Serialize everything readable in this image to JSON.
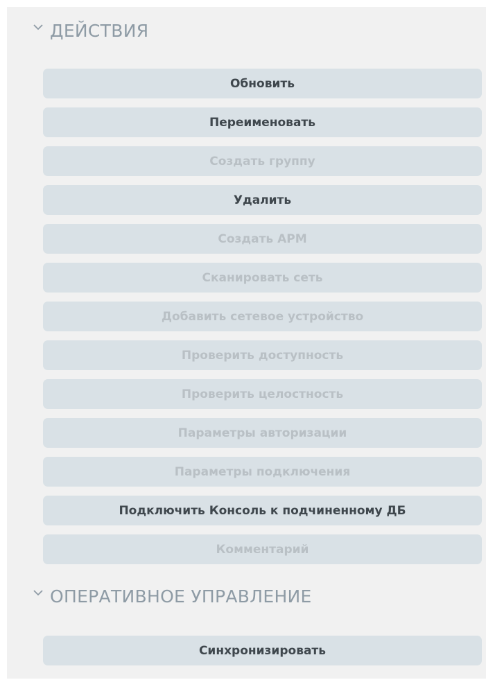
{
  "sections": [
    {
      "title": "ДЕЙСТВИЯ",
      "buttons": [
        {
          "label": "Обновить",
          "enabled": true
        },
        {
          "label": "Переименовать",
          "enabled": true
        },
        {
          "label": "Создать группу",
          "enabled": false
        },
        {
          "label": "Удалить",
          "enabled": true
        },
        {
          "label": "Создать АРМ",
          "enabled": false
        },
        {
          "label": "Сканировать сеть",
          "enabled": false
        },
        {
          "label": "Добавить сетевое устройство",
          "enabled": false
        },
        {
          "label": "Проверить доступность",
          "enabled": false
        },
        {
          "label": "Проверить целостность",
          "enabled": false
        },
        {
          "label": "Параметры авторизации",
          "enabled": false
        },
        {
          "label": "Параметры подключения",
          "enabled": false
        },
        {
          "label": "Подключить Консоль к подчиненному ДБ",
          "enabled": true
        },
        {
          "label": "Комментарий",
          "enabled": false
        }
      ]
    },
    {
      "title": "ОПЕРАТИВНОЕ УПРАВЛЕНИЕ",
      "buttons": [
        {
          "label": "Синхронизировать",
          "enabled": true
        }
      ]
    }
  ],
  "colors": {
    "panel_background": "#f1f1f1",
    "button_background": "#d9e1e6",
    "enabled_text": "#3f474d",
    "disabled_text": "#b9c0c5",
    "section_title": "#8e9ba5"
  },
  "icons": {
    "section_toggle": "chevron-down-icon"
  }
}
